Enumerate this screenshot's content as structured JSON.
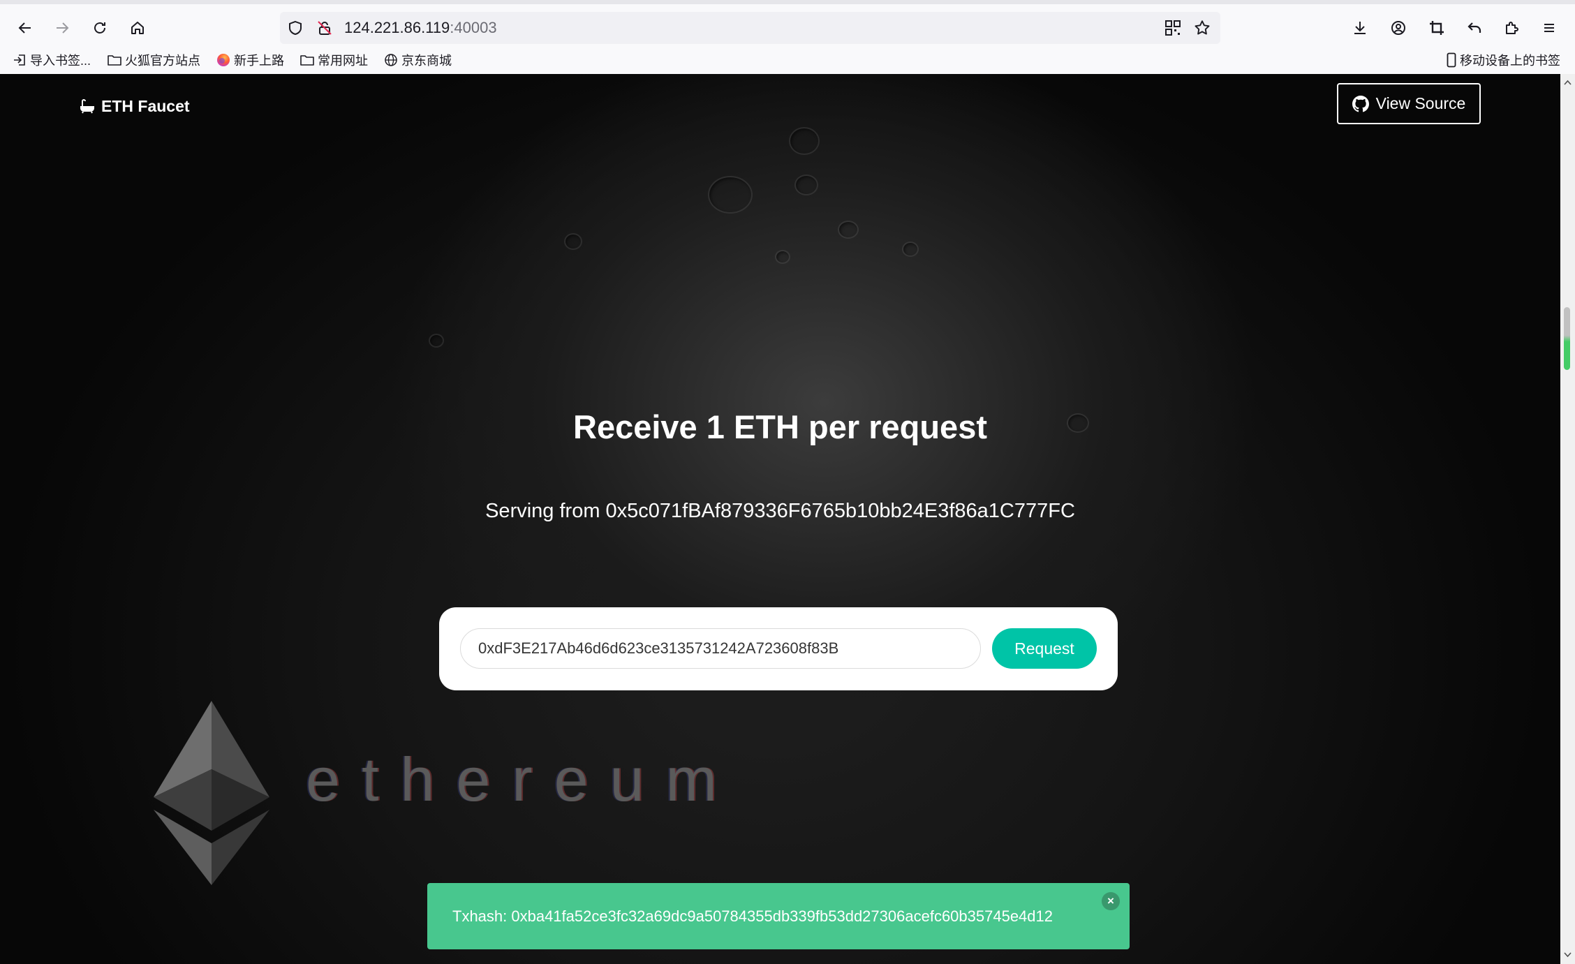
{
  "browser": {
    "url_host": "124.221.86.119",
    "url_port": ":40003",
    "bookmarks": [
      {
        "label": "导入书签...",
        "icon": "import-icon"
      },
      {
        "label": "火狐官方站点",
        "icon": "folder-icon"
      },
      {
        "label": "新手上路",
        "icon": "firefox-icon"
      },
      {
        "label": "常用网址",
        "icon": "folder-icon"
      },
      {
        "label": "京东商城",
        "icon": "globe-icon"
      }
    ],
    "mobile_bookmarks": "移动设备上的书签"
  },
  "page": {
    "brand": "ETH Faucet",
    "view_source": "View Source",
    "headline": "Receive 1 ETH per request",
    "serving": "Serving from 0x5c071fBAf879336F6765b10bb24E3f86a1C777FC",
    "address_value": "0xdF3E217Ab46d6d623ce3135731242A723608f83B",
    "request_label": "Request",
    "eth_word": "ethereum",
    "toast": "Txhash: 0xba41fa52ce3fc32a69dc9a50784355db339fb53dd27306acefc60b35745e4d12",
    "toast_close": "×"
  },
  "colors": {
    "request_button": "#00c4a7",
    "toast_background": "#48c78e"
  }
}
